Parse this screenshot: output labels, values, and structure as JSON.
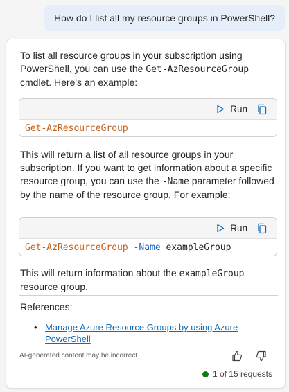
{
  "user_message": "How do I list all my resource groups in PowerShell?",
  "response": {
    "intro": {
      "before": "To list all resource groups in your subscription using PowerShell, you can use the ",
      "code": "Get-AzResourceGroup",
      "after": " cmdlet. Here's an example:"
    },
    "code_block_1": {
      "run_label": "Run",
      "command": "Get-AzResourceGroup"
    },
    "middle": {
      "before": "This will return a list of all resource groups in your subscription. If you want to get information about a specific resource group, you can use the ",
      "code": "-Name",
      "after": " parameter followed by the name of the resource group. For example:"
    },
    "code_block_2": {
      "run_label": "Run",
      "command": "Get-AzResourceGroup",
      "param": "-Name",
      "arg": "exampleGroup"
    },
    "outro": {
      "before": "This will return information about the ",
      "code": "exampleGroup",
      "after": " resource group."
    },
    "references": {
      "label": "References:",
      "items": [
        {
          "text": "Manage Azure Resource Groups by using Azure PowerShell"
        }
      ]
    },
    "disclaimer": "AI-generated content may be incorrect",
    "status": "1 of 15 requests"
  },
  "colors": {
    "accent_link": "#0f6cbd",
    "code_cmd": "#c4601b",
    "code_param": "#1c5ec4",
    "status_dot": "#107c10",
    "user_bubble": "#e6eef9"
  },
  "icons": {
    "run": "play-icon",
    "copy": "copy-icon",
    "like": "thumbs-up-icon",
    "dislike": "thumbs-down-icon"
  }
}
